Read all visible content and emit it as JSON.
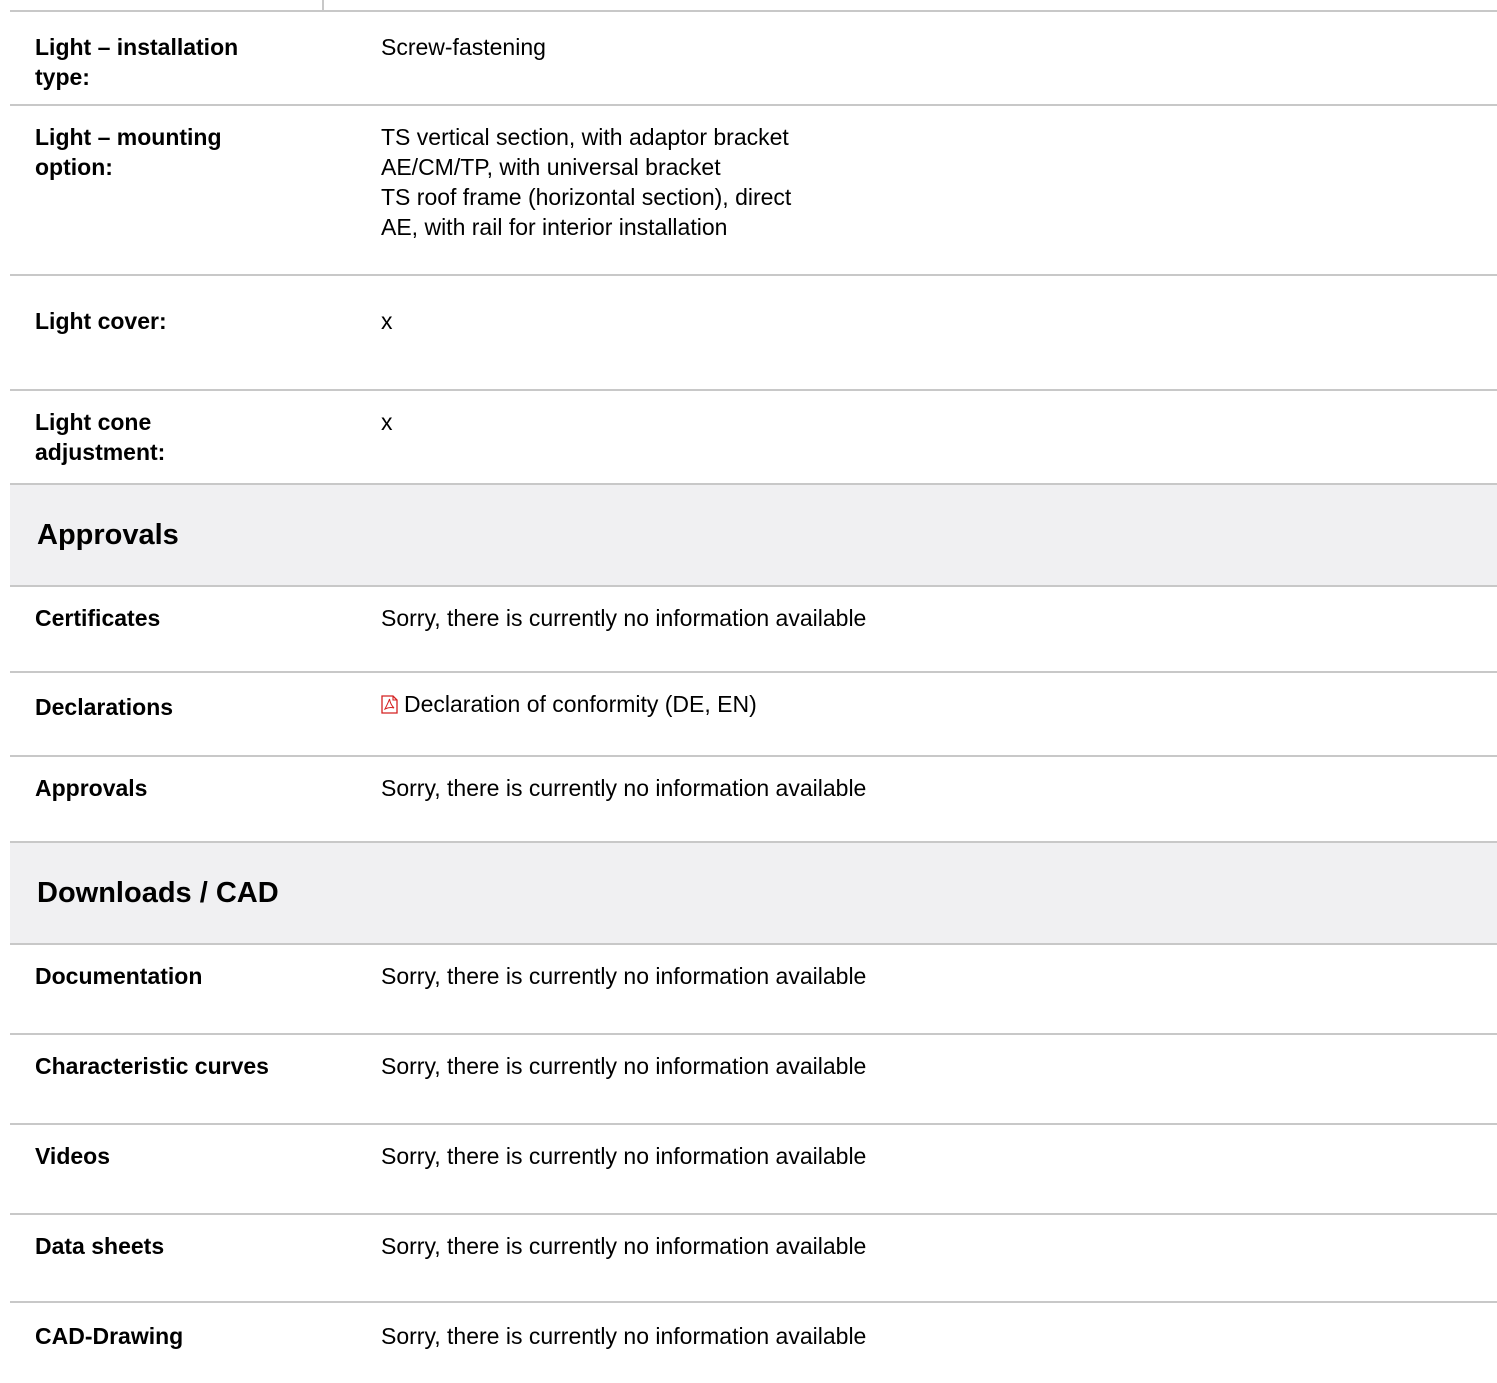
{
  "specs": [
    {
      "label": "Light – installation type:",
      "values": [
        "Screw-fastening"
      ]
    },
    {
      "label": "Light – mounting option:",
      "values": [
        "TS vertical section, with adaptor bracket",
        "AE/CM/TP, with universal bracket",
        "TS roof frame (horizontal section), direct",
        "AE, with rail for interior installation"
      ]
    },
    {
      "label": "Light cover:",
      "values": [
        "x"
      ]
    },
    {
      "label": "Light cone adjustment:",
      "values": [
        "x"
      ]
    }
  ],
  "approvals": {
    "title": "Approvals",
    "rows": [
      {
        "label": "Certificates",
        "value": "Sorry, there is currently no information available"
      },
      {
        "label": "Declarations",
        "link": "Declaration of conformity (DE, EN)",
        "icon": "pdf-icon"
      },
      {
        "label": "Approvals",
        "value": "Sorry, there is currently no information available"
      }
    ]
  },
  "downloads": {
    "title": "Downloads / CAD",
    "rows": [
      {
        "label": "Documentation",
        "value": "Sorry, there is currently no information available"
      },
      {
        "label": "Characteristic curves",
        "value": "Sorry, there is currently no information available"
      },
      {
        "label": "Videos",
        "value": "Sorry, there is currently no information available"
      },
      {
        "label": "Data sheets",
        "value": "Sorry, there is currently no information available"
      },
      {
        "label": "CAD-Drawing",
        "value": "Sorry, there is currently no information available"
      }
    ]
  },
  "colors": {
    "divider": "#c8c8c8",
    "section_bg": "#f0f0f2",
    "pdf_red": "#d42020"
  }
}
